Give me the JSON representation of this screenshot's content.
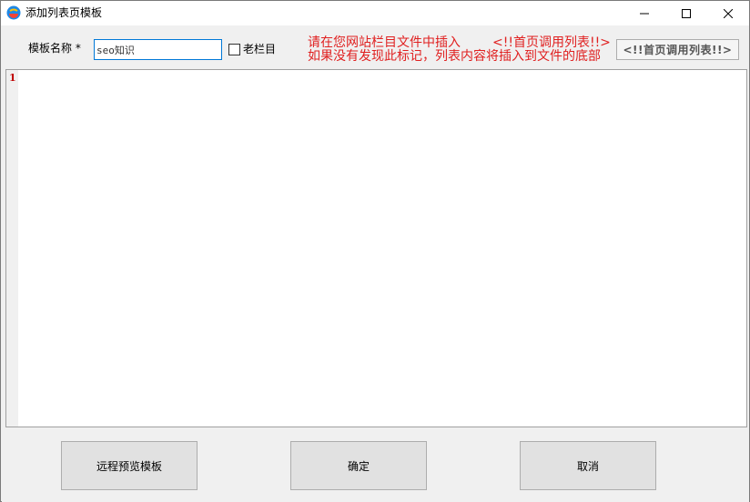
{
  "window": {
    "title": "添加列表页模板",
    "app_icon": "app-logo-icon"
  },
  "form": {
    "name_label": "模板名称 *",
    "name_value": "seo知识",
    "checkbox_label": "老栏目",
    "checkbox_checked": false
  },
  "hint": {
    "line1": "请在您网站栏目文件中插入",
    "tag": "<!!首页调用列表!!>",
    "line2": "如果没有发现此标记，列表内容将插入到文件的底部",
    "color": "#e02020"
  },
  "insert_button": {
    "label": "<!!首页调用列表!!>"
  },
  "editor": {
    "line_numbers": [
      "1"
    ],
    "content": ""
  },
  "footer": {
    "preview_label": "远程预览模板",
    "ok_label": "确定",
    "cancel_label": "取消"
  }
}
